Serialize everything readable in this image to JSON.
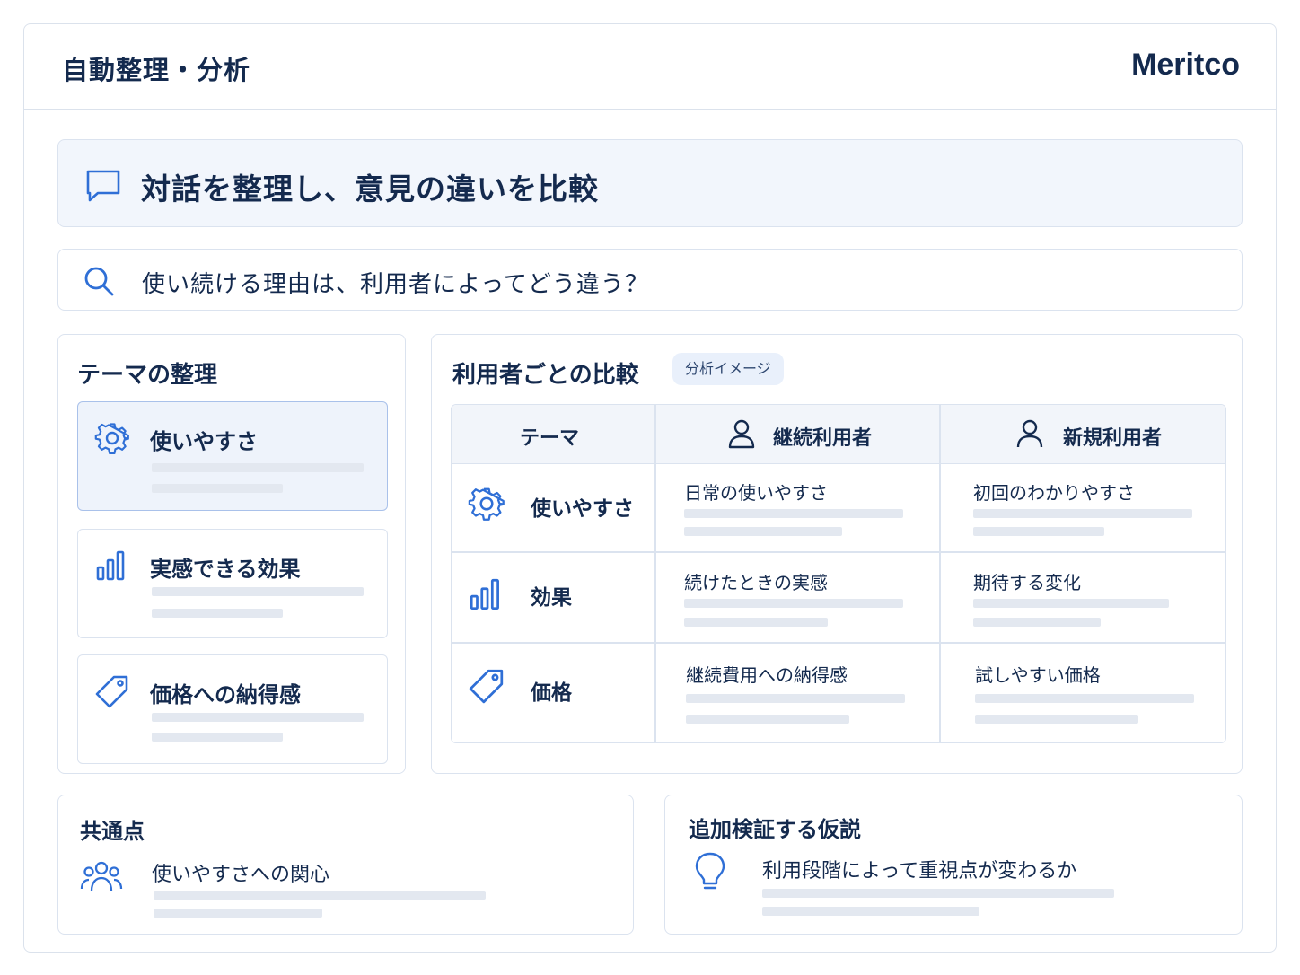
{
  "app": {
    "title": "自動整理・分析",
    "brand": "Meritco"
  },
  "banner": {
    "title": "対話を整理し、意見の違いを比較",
    "icon": "chat-bubble-icon"
  },
  "search": {
    "query": "使い続ける理由は、利用者によってどう違う？",
    "icon": "search-icon"
  },
  "themes": {
    "title": "テーマの整理",
    "items": [
      {
        "label": "使いやすさ",
        "icon": "gear-icon",
        "active": true
      },
      {
        "label": "実感できる効果",
        "icon": "bar-chart-icon",
        "active": false
      },
      {
        "label": "価格への納得感",
        "icon": "tag-icon",
        "active": false
      }
    ]
  },
  "compare": {
    "title": "利用者ごとの比較",
    "badge": "分析イメージ",
    "columns": [
      "テーマ",
      "継続利用者",
      "新規利用者"
    ],
    "rows": [
      {
        "theme": "使いやすさ",
        "icon": "gear-icon",
        "continuing": "日常の使いやすさ",
        "new": "初回のわかりやすさ"
      },
      {
        "theme": "効果",
        "icon": "bar-chart-icon",
        "continuing": "続けたときの実感",
        "new": "期待する変化"
      },
      {
        "theme": "価格",
        "icon": "tag-icon",
        "continuing": "継続費用への納得感",
        "new": "試しやすい価格"
      }
    ]
  },
  "common": {
    "title": "共通点",
    "text": "使いやすさへの関心",
    "icon": "users-icon"
  },
  "hypothesis": {
    "title": "追加検証する仮説",
    "text": "利用段階によって重視点が変わるか",
    "icon": "lightbulb-icon"
  },
  "colors": {
    "accent": "#2f6fd6",
    "text": "#142a4e",
    "border": "#dbe3ef",
    "placeholder": "#e3e8f0"
  }
}
